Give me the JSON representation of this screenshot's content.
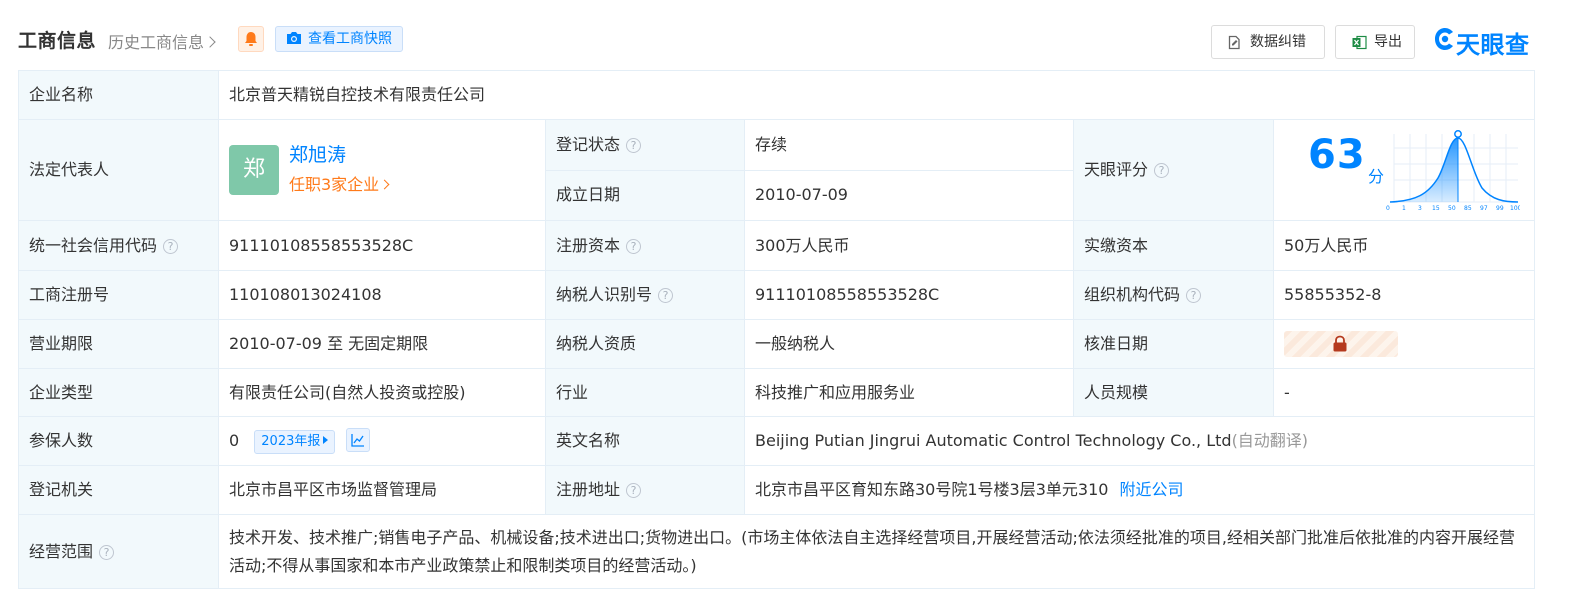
{
  "header": {
    "title": "工商信息",
    "history_link": "历史工商信息",
    "snapshot_button": "查看工商快照",
    "correction_button": "数据纠错",
    "export_button": "导出",
    "logo_text": "天眼查"
  },
  "company": {
    "name_label": "企业名称",
    "name": "北京普天精锐自控技术有限责任公司",
    "legal_rep_label": "法定代表人",
    "legal_rep_avatar": "郑",
    "legal_rep_name": "郑旭涛",
    "legal_rep_positions": "任职3家企业",
    "reg_status_label": "登记状态",
    "reg_status": "存续",
    "founded_label": "成立日期",
    "founded": "2010-07-09",
    "score_label": "天眼评分",
    "score": "63",
    "score_unit": "分",
    "score_axis": [
      "0",
      "1",
      "3",
      "15",
      "50",
      "85",
      "97",
      "99",
      "100"
    ],
    "credit_code_label": "统一社会信用代码",
    "credit_code": "91110108558553528C",
    "reg_capital_label": "注册资本",
    "reg_capital": "300万人民币",
    "paid_capital_label": "实缴资本",
    "paid_capital": "50万人民币",
    "reg_no_label": "工商注册号",
    "reg_no": "110108013024108",
    "taxpayer_id_label": "纳税人识别号",
    "taxpayer_id": "91110108558553528C",
    "org_code_label": "组织机构代码",
    "org_code": "55855352-8",
    "term_label": "营业期限",
    "term": "2010-07-09 至 无固定期限",
    "taxpayer_qual_label": "纳税人资质",
    "taxpayer_qual": "一般纳税人",
    "approval_date_label": "核准日期",
    "type_label": "企业类型",
    "type": "有限责任公司(自然人投资或控股)",
    "industry_label": "行业",
    "industry": "科技推广和应用服务业",
    "staff_size_label": "人员规模",
    "staff_size": "-",
    "insured_label": "参保人数",
    "insured": "0",
    "insured_year_tag": "2023年报",
    "english_name_label": "英文名称",
    "english_name": "Beijing Putian Jingrui Automatic Control Technology Co., Ltd",
    "english_name_note": "(自动翻译)",
    "authority_label": "登记机关",
    "authority": "北京市昌平区市场监督管理局",
    "address_label": "注册地址",
    "address": "北京市昌平区育知东路30号院1号楼3层3单元310",
    "nearby_link": "附近公司",
    "scope_label": "经营范围",
    "scope": "技术开发、技术推广;销售电子产品、机械设备;技术进出口;货物进出口。(市场主体依法自主选择经营项目,开展经营活动;依法须经批准的项目,经相关部门批准后依批准的内容开展经营活动;不得从事国家和本市产业政策禁止和限制类项目的经营活动。)"
  },
  "colors": {
    "accent": "#0084ff",
    "status_green": "#009944",
    "orange": "#ff7a1a",
    "label_bg": "#f2f9fc",
    "border": "#e4eef6"
  }
}
